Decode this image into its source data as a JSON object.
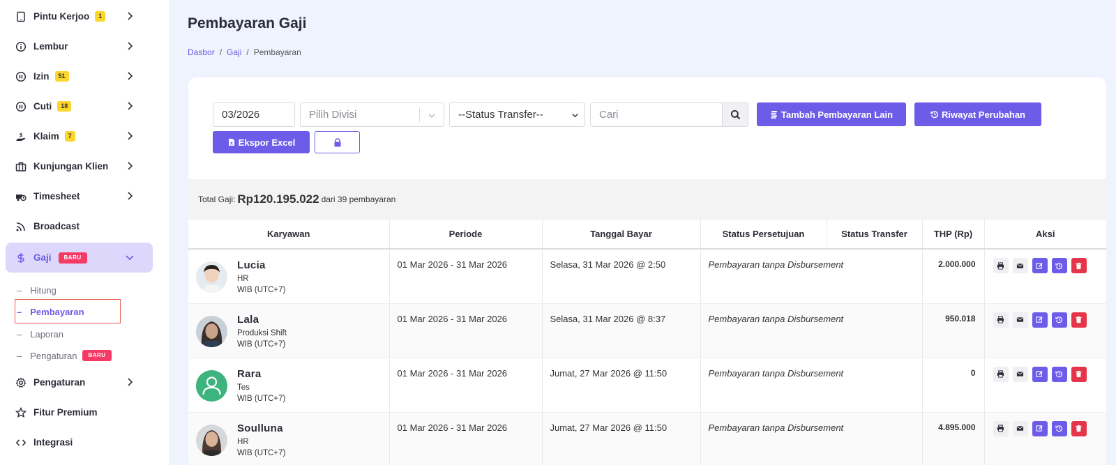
{
  "sidebar": {
    "items": [
      {
        "label": "Pintu Kerjoo",
        "badge": "1",
        "icon": "tablet-icon"
      },
      {
        "label": "Lembur",
        "icon": "info-circle-icon"
      },
      {
        "label": "Izin",
        "badge": "51",
        "icon": "pause-circle-icon"
      },
      {
        "label": "Cuti",
        "badge": "18",
        "icon": "pause-circle-icon"
      },
      {
        "label": "Klaim",
        "badge": "7",
        "icon": "hand-coin-icon"
      },
      {
        "label": "Kunjungan Klien",
        "icon": "briefcase-icon"
      },
      {
        "label": "Timesheet",
        "icon": "truck-clock-icon"
      },
      {
        "label": "Broadcast",
        "icon": "rss-icon"
      },
      {
        "label": "Gaji",
        "badge": "BARU",
        "icon": "dollar-icon"
      }
    ],
    "gaji_sub": [
      {
        "label": "Hitung"
      },
      {
        "label": "Pembayaran"
      },
      {
        "label": "Laporan"
      },
      {
        "label": "Pengaturan",
        "badge": "BARU"
      }
    ],
    "bottom_items": [
      {
        "label": "Pengaturan",
        "icon": "gear-icon"
      },
      {
        "label": "Fitur Premium",
        "icon": "star-icon"
      },
      {
        "label": "Integrasi",
        "icon": "code-icon"
      }
    ]
  },
  "page": {
    "title": "Pembayaran Gaji",
    "breadcrumb": [
      "Dasbor",
      "Gaji",
      "Pembayaran"
    ]
  },
  "filters": {
    "period_value": "03/2026",
    "division_placeholder": "Pilih Divisi",
    "status_transfer_value": "--Status Transfer--",
    "search_placeholder": "Cari",
    "add_payment_label": "Tambah Pembayaran Lain",
    "history_label": "Riwayat Perubahan",
    "export_label": "Ekspor Excel"
  },
  "summary": {
    "prefix": "Total Gaji:",
    "total": "Rp120.195.022",
    "suffix": "dari 39 pembayaran"
  },
  "table": {
    "headers": [
      "Karyawan",
      "Periode",
      "Tanggal Bayar",
      "Status Persetujuan",
      "Status Transfer",
      "THP (Rp)",
      "Aksi"
    ],
    "rows": [
      {
        "name": "Lucia",
        "division": "HR",
        "tz": "WIB (UTC+7)",
        "period": "01 Mar 2026 - 31 Mar 2026",
        "paid": "Selasa, 31 Mar 2026 @ 2:50",
        "approval": "Pembayaran tanpa Disbursement",
        "transfer": "",
        "thp": "2.000.000"
      },
      {
        "name": "Lala",
        "division": "Produksi Shift",
        "tz": "WIB (UTC+7)",
        "period": "01 Mar 2026 - 31 Mar 2026",
        "paid": "Selasa, 31 Mar 2026 @ 8:37",
        "approval": "Pembayaran tanpa Disbursement",
        "transfer": "",
        "thp": "950.018"
      },
      {
        "name": "Rara",
        "division": "Tes",
        "tz": "WIB (UTC+7)",
        "period": "01 Mar 2026 - 31 Mar 2026",
        "paid": "Jumat, 27 Mar 2026 @ 11:50",
        "approval": "Pembayaran tanpa Disbursement",
        "transfer": "",
        "thp": "0"
      },
      {
        "name": "Soulluna",
        "division": "HR",
        "tz": "WIB (UTC+7)",
        "period": "01 Mar 2026 - 31 Mar 2026",
        "paid": "Jumat, 27 Mar 2026 @ 11:50",
        "approval": "Pembayaran tanpa Disbursement",
        "transfer": "",
        "thp": "4.895.000"
      }
    ]
  },
  "colors": {
    "accent": "#6c5ce7",
    "danger": "#e63548",
    "badge_yellow": "#fcd62b",
    "badge_red": "#f53a66"
  }
}
